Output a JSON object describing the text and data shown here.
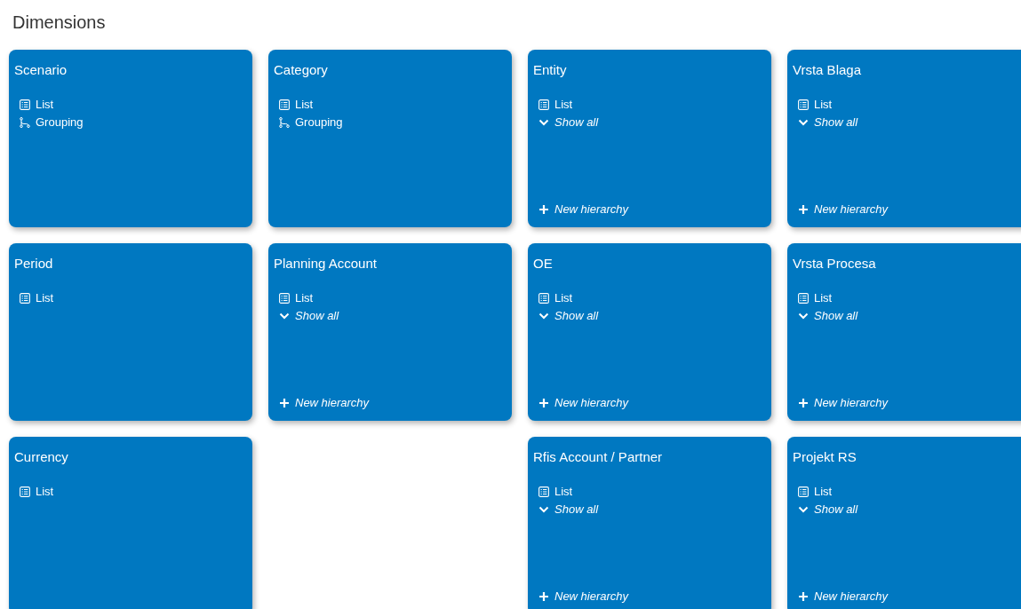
{
  "title": "Dimensions",
  "cards": [
    {
      "kind": "card",
      "title": "Scenario",
      "items": [
        {
          "kind": "list",
          "label": "List"
        },
        {
          "kind": "grouping",
          "label": "Grouping"
        }
      ]
    },
    {
      "kind": "card",
      "title": "Category",
      "items": [
        {
          "kind": "list",
          "label": "List"
        },
        {
          "kind": "grouping",
          "label": "Grouping"
        }
      ]
    },
    {
      "kind": "card",
      "title": "Entity",
      "items": [
        {
          "kind": "list",
          "label": "List"
        },
        {
          "kind": "show_all",
          "label": "Show all"
        }
      ],
      "action": "New hierarchy"
    },
    {
      "kind": "card",
      "title": "Vrsta Blaga",
      "items": [
        {
          "kind": "list",
          "label": "List"
        },
        {
          "kind": "show_all",
          "label": "Show all"
        }
      ],
      "action": "New hierarchy"
    },
    {
      "kind": "card",
      "title": "Period",
      "items": [
        {
          "kind": "list",
          "label": "List"
        }
      ]
    },
    {
      "kind": "card",
      "title": "Planning Account",
      "items": [
        {
          "kind": "list",
          "label": "List"
        },
        {
          "kind": "show_all",
          "label": "Show all"
        }
      ],
      "action": "New hierarchy"
    },
    {
      "kind": "card",
      "title": "OE",
      "items": [
        {
          "kind": "list",
          "label": "List"
        },
        {
          "kind": "show_all",
          "label": "Show all"
        }
      ],
      "action": "New hierarchy"
    },
    {
      "kind": "card",
      "title": "Vrsta Procesa",
      "items": [
        {
          "kind": "list",
          "label": "List"
        },
        {
          "kind": "show_all",
          "label": "Show all"
        }
      ],
      "action": "New hierarchy"
    },
    {
      "kind": "card",
      "title": "Currency",
      "items": [
        {
          "kind": "list",
          "label": "List"
        }
      ]
    },
    {
      "kind": "empty"
    },
    {
      "kind": "card",
      "title": "Rfis Account / Partner",
      "items": [
        {
          "kind": "list",
          "label": "List"
        },
        {
          "kind": "show_all",
          "label": "Show all"
        }
      ],
      "action": "New hierarchy"
    },
    {
      "kind": "card",
      "title": "Projekt RS",
      "items": [
        {
          "kind": "list",
          "label": "List"
        },
        {
          "kind": "show_all",
          "label": "Show all"
        }
      ],
      "action": "New hierarchy"
    }
  ]
}
